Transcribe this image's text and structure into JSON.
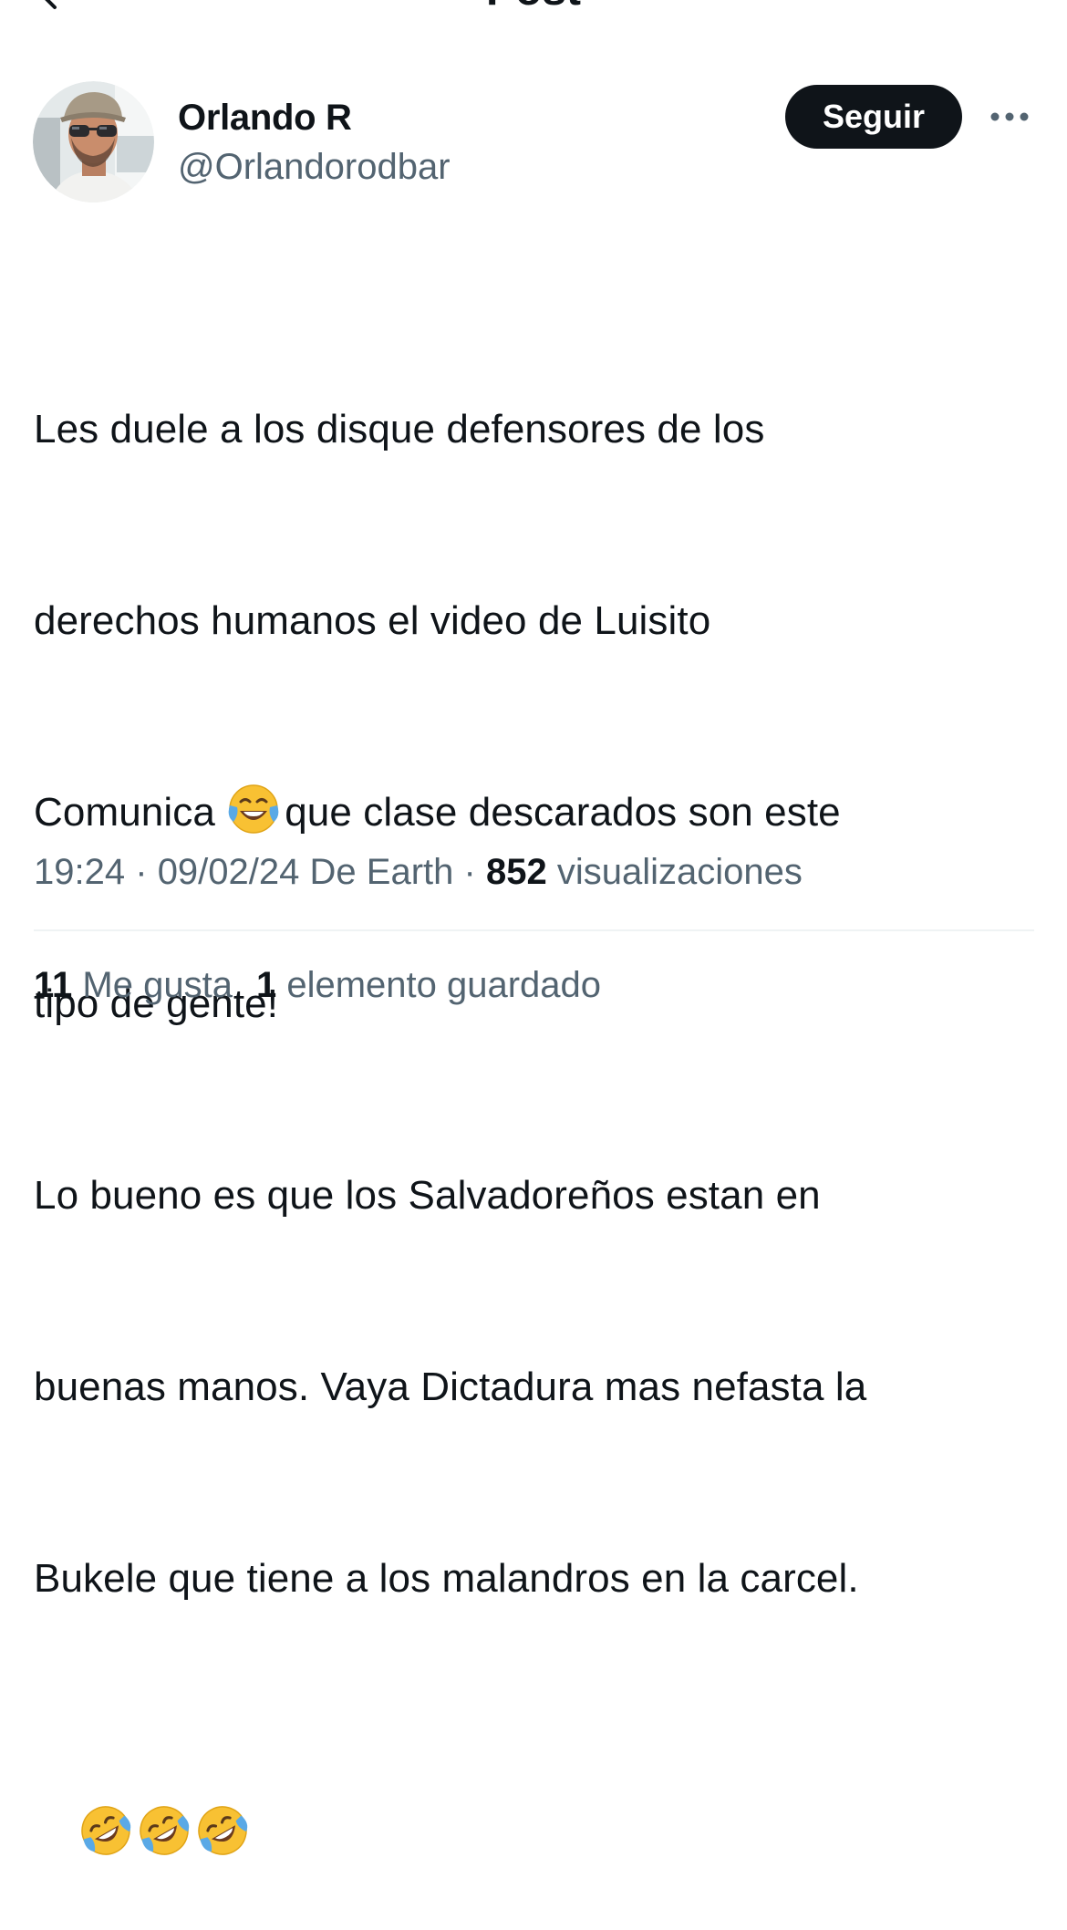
{
  "header": {
    "title": "Post"
  },
  "author": {
    "name": "Orlando R",
    "handle": "@Orlandorodbar"
  },
  "actions": {
    "follow_label": "Seguir"
  },
  "post": {
    "lines": [
      "Les duele a los disque defensores de los",
      "derechos humanos el video de Luisito",
      "que clase descarados son este",
      "tipo de gente!",
      "Lo bueno es que los Salvadoreños estan en",
      "buenas manos. Vaya Dictadura mas nefasta la",
      "Bukele que tiene a los malandros en la carcel."
    ],
    "line3_prefix": "Comunica "
  },
  "meta": {
    "time": "19:24",
    "date": "09/02/24",
    "source": "De Earth",
    "separator": "·",
    "views_count": "852",
    "views_label": "visualizaciones"
  },
  "stats": {
    "likes_count": "11",
    "likes_label": "Me gusta",
    "bookmarks_count": "1",
    "bookmarks_label": "elemento guardado"
  },
  "colors": {
    "text_primary": "#0f1419",
    "text_secondary": "#536471",
    "button_bg": "#0f1419",
    "divider": "#eff3f4",
    "emoji_yellow": "#f8c133",
    "tear_blue": "#5aa9e6"
  },
  "icons": {
    "back": "back-arrow-icon",
    "more": "more-options-icon",
    "tears_of_joy": "face-with-tears-of-joy-emoji",
    "rofl": "rolling-on-floor-laughing-emoji"
  }
}
